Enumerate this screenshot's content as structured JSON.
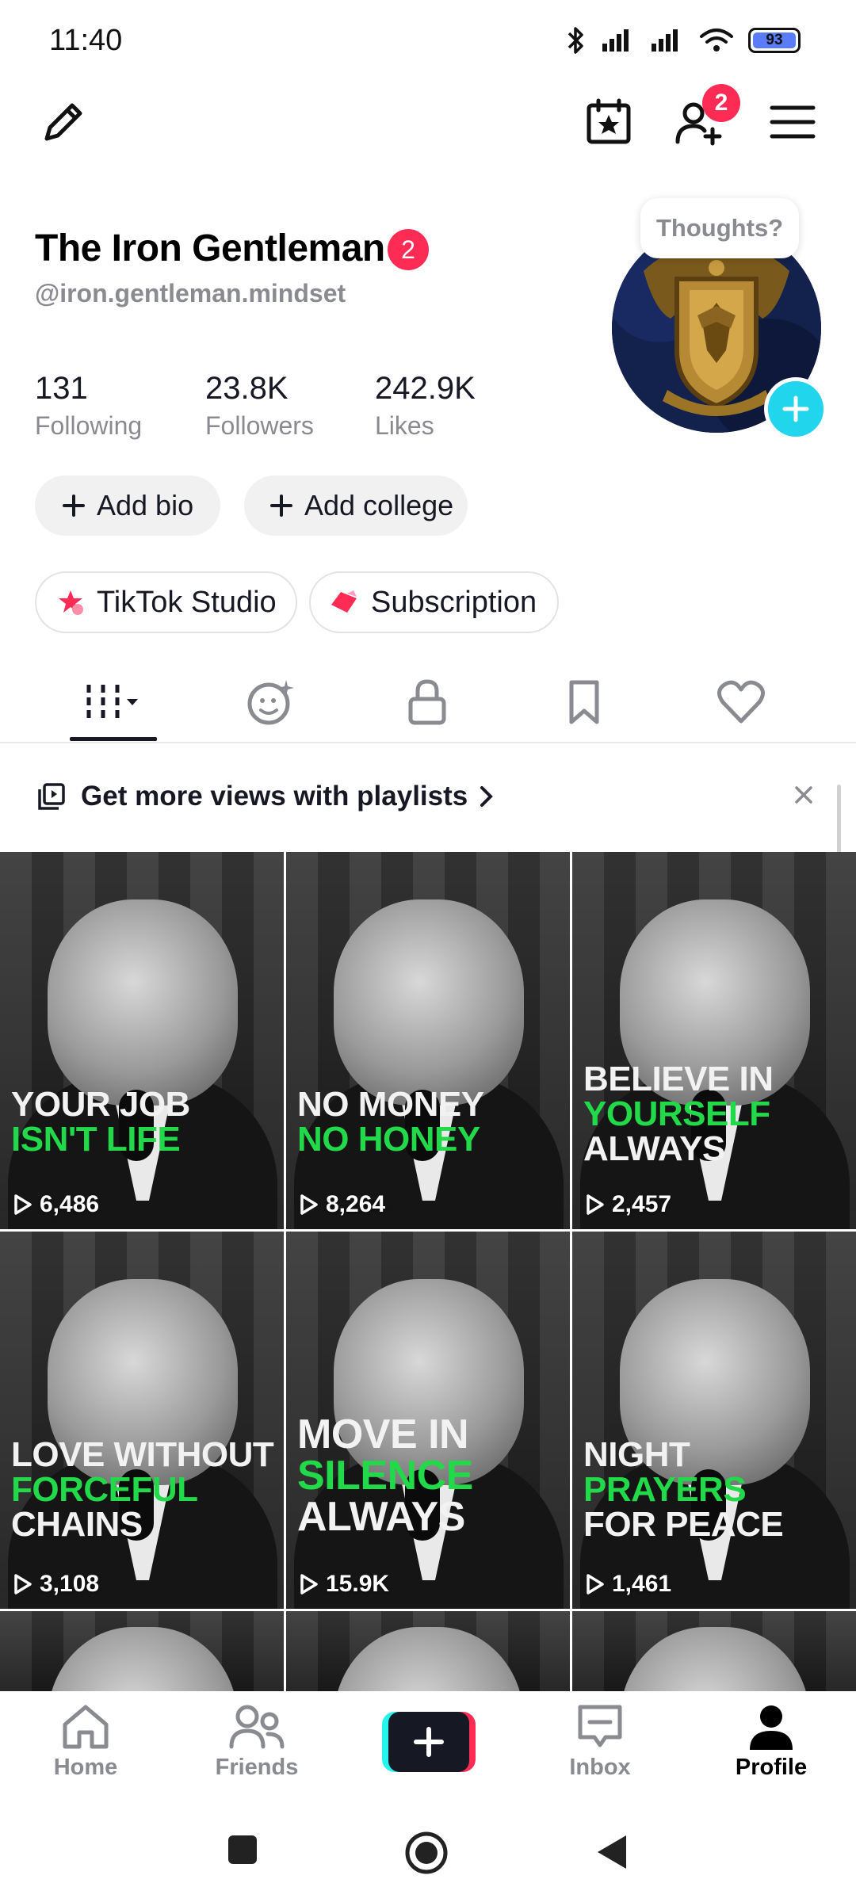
{
  "status_bar": {
    "time": "11:40",
    "battery": "93",
    "icons": [
      "bluetooth-icon",
      "signal-icon",
      "signal-icon",
      "wifi-icon",
      "battery-icon"
    ]
  },
  "top_bar": {
    "edit_icon": "pencil-icon",
    "calendar_icon": "calendar-star-icon",
    "add_friend_icon": "add-user-icon",
    "add_friend_badge": "2",
    "menu_icon": "hamburger-menu-icon"
  },
  "profile": {
    "display_name": "The Iron Gentleman",
    "name_badge": "2",
    "username": "@iron.gentleman.mindset",
    "thought_bubble": "Thoughts?",
    "stats": [
      {
        "value": "131",
        "label": "Following"
      },
      {
        "value": "23.8K",
        "label": "Followers"
      },
      {
        "value": "242.9K",
        "label": "Likes"
      }
    ],
    "add_bio": "Add bio",
    "add_college": "Add college",
    "tiktok_studio": "TikTok Studio",
    "subscription": "Subscription"
  },
  "tabs": [
    {
      "name": "videos-tab",
      "icon": "grid-icon"
    },
    {
      "name": "reposts-tab",
      "icon": "repost-face-icon"
    },
    {
      "name": "private-tab",
      "icon": "lock-icon"
    },
    {
      "name": "saved-tab",
      "icon": "bookmark-icon"
    },
    {
      "name": "liked-tab",
      "icon": "heart-icon"
    }
  ],
  "banner": {
    "text": "Get more views with playlists",
    "close": "×"
  },
  "videos": [
    {
      "caption_lines": [
        {
          "text": "YOUR JOB",
          "color": "white"
        },
        {
          "text": "ISN'T LIFE",
          "color": "green"
        }
      ],
      "views": "6,486"
    },
    {
      "caption_lines": [
        {
          "text": "NO MONEY",
          "color": "white"
        },
        {
          "text": "NO HONEY",
          "color": "green"
        }
      ],
      "views": "8,264"
    },
    {
      "caption_lines": [
        {
          "text": "BELIEVE IN",
          "color": "white"
        },
        {
          "text": "YOURSELF",
          "color": "green"
        },
        {
          "text": "ALWAYS",
          "color": "white"
        }
      ],
      "views": "2,457"
    },
    {
      "caption_lines": [
        {
          "text": "LOVE WITHOUT",
          "color": "white"
        },
        {
          "text": "FORCEFUL",
          "color": "green"
        },
        {
          "text": "CHAINS",
          "color": "white"
        }
      ],
      "views": "3,108"
    },
    {
      "caption_lines": [
        {
          "text": "MOVE IN",
          "color": "white"
        },
        {
          "text": "SILENCE",
          "color": "green"
        },
        {
          "text": "ALWAYS",
          "color": "white"
        }
      ],
      "views": "15.9K"
    },
    {
      "caption_lines": [
        {
          "text": "NIGHT PRAYERS",
          "color": "mixed"
        },
        {
          "text": "FOR PEACE",
          "color": "white"
        }
      ],
      "views": "1,461"
    }
  ],
  "bottom_nav": {
    "home": "Home",
    "friends": "Friends",
    "inbox": "Inbox",
    "profile": "Profile"
  },
  "colors": {
    "accent_red": "#fe2c55",
    "accent_cyan": "#20d5ec",
    "caption_green": "#22d94a",
    "battery_fill": "#5b7cf7"
  }
}
